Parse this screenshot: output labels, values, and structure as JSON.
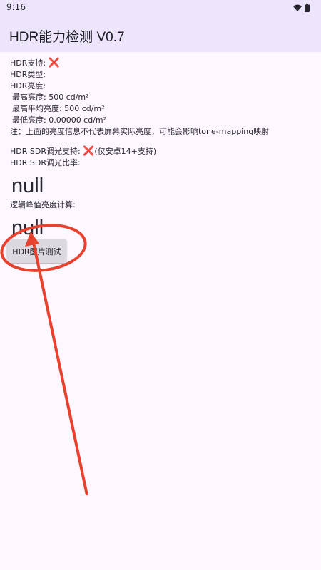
{
  "status_bar": {
    "time": "9:16",
    "icons": [
      "wifi-icon",
      "battery-icon"
    ]
  },
  "app_bar": {
    "title": "HDR能力检测 V0.7"
  },
  "info": {
    "hdr_support_label": "HDR支持: ",
    "hdr_support_value": "❌",
    "hdr_type": "HDR类型:",
    "hdr_brightness": "HDR亮度:",
    "max_brightness": "最高亮度: 500 cd/m²",
    "max_avg_brightness": "最高平均亮度: 500 cd/m²",
    "min_brightness": "最低亮度: 0.00000 cd/m²",
    "note": "注：上面的亮度信息不代表屏幕实际亮度，可能会影响tone-mapping映射",
    "sdr_dimming_label": "HDR SDR调光支持: ",
    "sdr_dimming_value": "❌",
    "sdr_dimming_note": "(仅安卓14+支持)",
    "sdr_ratio_label": "HDR SDR调光比率:",
    "sdr_ratio_value": "null",
    "peak_label": "逻辑峰值亮度计算:",
    "peak_value": "null"
  },
  "actions": {
    "test_button_label": "HDR图片测试"
  },
  "colors": {
    "accent": "#ece5fb",
    "background": "#fdf7ff",
    "annotation": "#e8412d",
    "cross": "#e53935"
  }
}
